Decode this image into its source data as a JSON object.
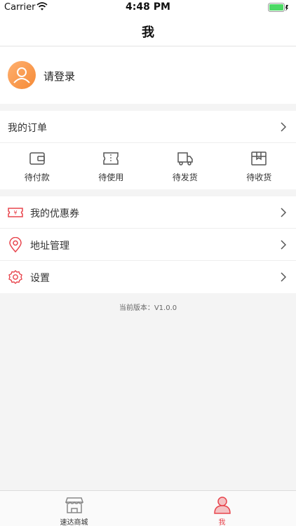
{
  "status_bar": {
    "carrier": "Carrier",
    "time": "4:48 PM"
  },
  "nav": {
    "title": "我"
  },
  "login": {
    "text": "请登录"
  },
  "orders": {
    "title": "我的订单",
    "items": [
      {
        "label": "待付款",
        "icon": "wallet-icon"
      },
      {
        "label": "待使用",
        "icon": "ticket-icon"
      },
      {
        "label": "待发货",
        "icon": "truck-icon"
      },
      {
        "label": "待收货",
        "icon": "package-icon"
      }
    ]
  },
  "menu": {
    "items": [
      {
        "label": "我的优惠券",
        "icon": "coupon-icon"
      },
      {
        "label": "地址管理",
        "icon": "location-pin-icon"
      },
      {
        "label": "设置",
        "icon": "settings-gear-icon"
      }
    ]
  },
  "version": "当前版本：V1.0.0",
  "tabs": [
    {
      "label": "速达商城",
      "icon": "shop-icon",
      "active": false
    },
    {
      "label": "我",
      "icon": "profile-icon",
      "active": true
    }
  ],
  "colors": {
    "accent": "#e8454d",
    "avatar": "#f58a36"
  }
}
